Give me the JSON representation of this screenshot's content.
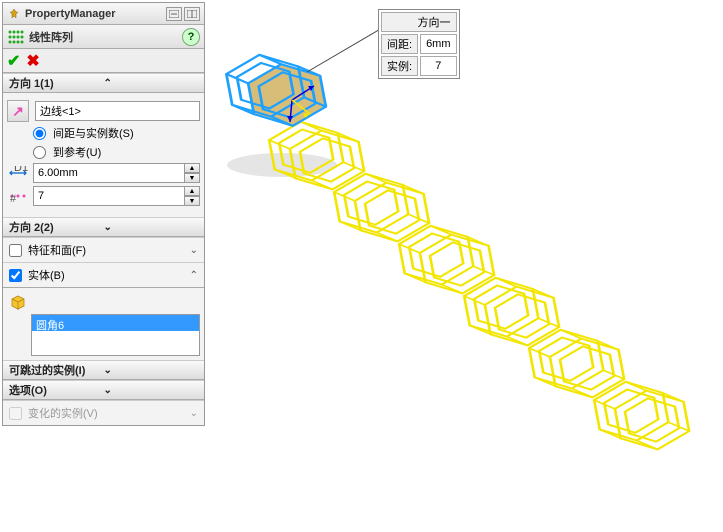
{
  "header": {
    "title": "PropertyManager"
  },
  "feature": {
    "name": "线性阵列"
  },
  "direction1": {
    "label": "方向 1(1)",
    "edge_selection": "边线<1>",
    "radio_spacing": "间距与实例数(S)",
    "radio_ref": "到参考(U)",
    "spacing_value": "6.00mm",
    "count_value": "7"
  },
  "direction2": {
    "label": "方向 2(2)"
  },
  "features_faces": {
    "label": "特征和面(F)"
  },
  "bodies": {
    "label": "实体(B)",
    "selected_item": "圆角6"
  },
  "skip_instances": {
    "label": "可跳过的实例(I)"
  },
  "options": {
    "label": "选项(O)"
  },
  "varied_instances": {
    "label": "变化的实例(V)"
  },
  "callout": {
    "direction_label": "方向一",
    "spacing_label": "间距:",
    "spacing_value": "6mm",
    "count_label": "实例:",
    "count_value": "7"
  }
}
